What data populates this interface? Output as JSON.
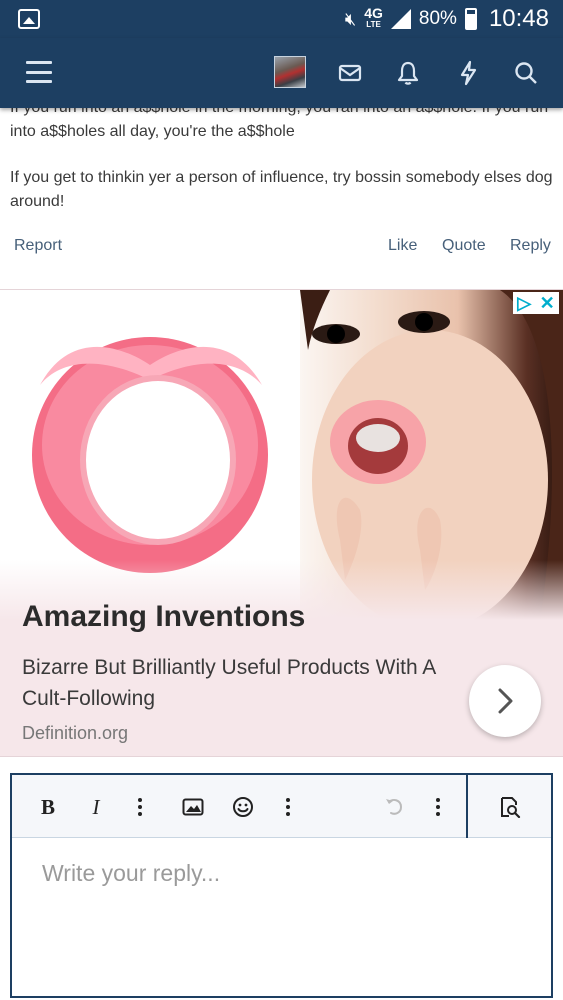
{
  "status_bar": {
    "network": "4G",
    "network_sub": "LTE",
    "battery": "80%",
    "time": "10:48",
    "icons": [
      "gallery-icon",
      "mute-icon",
      "signal-icon",
      "battery-icon"
    ]
  },
  "navbar": {
    "icons": [
      "menu-icon",
      "avatar",
      "mail-icon",
      "bell-icon",
      "bolt-icon",
      "search-icon"
    ]
  },
  "post": {
    "paragraphs": [
      "If you run into an a$$hole in the morning, you ran into an a$$hole. If you run into a$$holes all day, you're the a$$hole",
      "If you get to thinkin yer a person of influence, try bossin somebody elses dog around!"
    ],
    "actions": {
      "report": "Report",
      "like": "Like",
      "quote": "Quote",
      "reply": "Reply"
    }
  },
  "ad": {
    "title": "Amazing Inventions",
    "description": "Bizarre But Brilliantly Useful Products With A Cult-Following",
    "source": "Definition.org",
    "badge_color": "#00aecd"
  },
  "editor": {
    "toolbar": {
      "bold": "B",
      "italic": "I"
    },
    "placeholder": "Write your reply..."
  },
  "colors": {
    "header": "#1d3f62",
    "link": "#47607a",
    "ad_bg": "#f6e7ea"
  }
}
